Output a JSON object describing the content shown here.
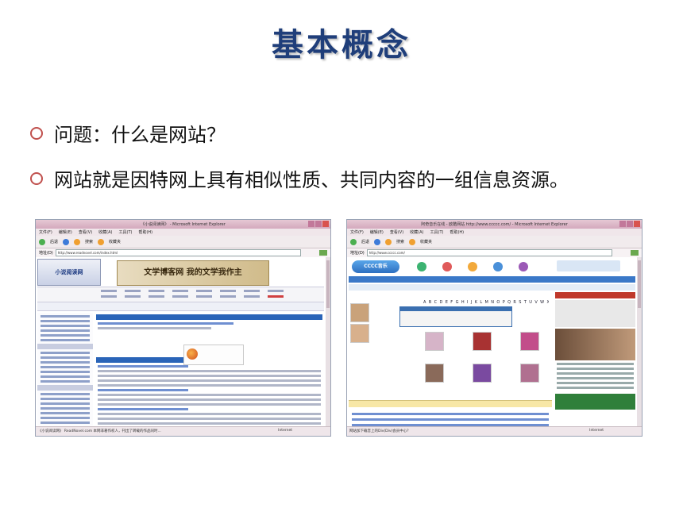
{
  "slide": {
    "title": "基本概念",
    "bullets": [
      "问题：什么是网站？",
      "网站就是因特网上具有相似性质、共同内容的一组信息资源。"
    ],
    "bullet_color": "#c0504d",
    "title_color": "#1f3e7a"
  },
  "left_window": {
    "title": "《小说阅读网》 - Microsoft Internet Explorer",
    "menu": [
      "文件(F)",
      "编辑(E)",
      "查看(V)",
      "收藏(A)",
      "工具(T)",
      "帮助(H)"
    ],
    "toolbar": [
      "后退",
      "搜索",
      "收藏夹"
    ],
    "address_label": "地址(D)",
    "address": "http://www.readnovel.com/index.html",
    "site_logo": "小说阅读网",
    "banner": "文学博客网 我的文学我作主",
    "status": "《小说阅读网》 ReadNovel.com 本网非著作权人，刊出了转载的作品同时...",
    "zone": "Internet"
  },
  "right_window": {
    "title": "阿奇音乐在线 - 欧酷网站 http://www.ccccc.com/ - Microsoft Internet Explorer",
    "menu": [
      "文件(F)",
      "编辑(E)",
      "查看(V)",
      "收藏(A)",
      "工具(T)",
      "帮助(H)"
    ],
    "toolbar": [
      "后退",
      "搜索",
      "收藏夹"
    ],
    "address_label": "地址(D)",
    "address": "http://www.ccccc.com/",
    "site_logo": "CCCC音乐",
    "alphabet": "A B C D E F G H I J K L M N O P Q R S T U V W X Y Z",
    "status": "网站加下载音上的Div(Div)会员中心？",
    "zone": "Internet"
  }
}
